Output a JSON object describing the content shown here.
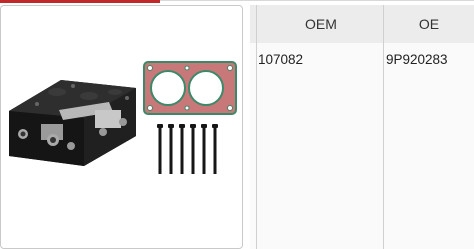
{
  "table": {
    "headers": [
      "OEM",
      "OE"
    ],
    "rows": [
      [
        "107082",
        "9P920283"
      ]
    ]
  },
  "colors": {
    "accent": "#c0282a",
    "header_bg": "#ececec",
    "gasket": "#c87878",
    "gasket_edge": "#3a8a6a"
  },
  "icons": {
    "product": "compressor-head-kit-image"
  }
}
